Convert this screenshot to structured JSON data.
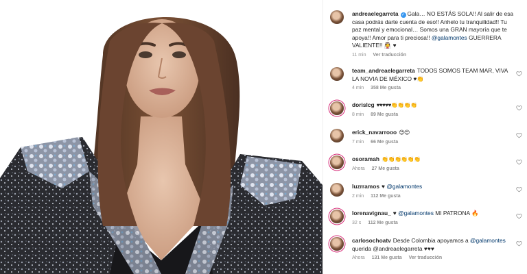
{
  "caption": {
    "username": "andreaelegarreta",
    "text_a": "Gala… NO ESTÁS SOLA!! Al salir de esa casa podrás darte cuenta de eso!! Anhelo tu tranquilidad!! Tu paz mental y emocional… Somos una GRAN mayoría que te apoya!! Amor para ti preciosa!!",
    "mention": "@galamontes",
    "text_b": "GUERRERA VALIENTE!! 👰 ♥",
    "time": "11 min",
    "translate": "Ver traducción"
  },
  "comments": [
    {
      "username": "team_andreaelegarreta",
      "text": "TODOS SOMOS TEAM MAR, VIVA LA NOVIA DE MÉXICO ♥👏",
      "mention": "",
      "text_after": "",
      "time": "4 min",
      "likes": "358 Me gusta",
      "extra": ""
    },
    {
      "username": "dorislcg",
      "text": "♥♥♥♥♥👏👏👏👏",
      "mention": "",
      "text_after": "",
      "time": "8 min",
      "likes": "89 Me gusta",
      "extra": ""
    },
    {
      "username": "erick_navarrooo",
      "text": "😍😍",
      "mention": "",
      "text_after": "",
      "time": "7 min",
      "likes": "66 Me gusta",
      "extra": ""
    },
    {
      "username": "osoramah",
      "text": "👏👏👏👏👏👏",
      "mention": "",
      "text_after": "",
      "time": "Ahora",
      "likes": "27 Me gusta",
      "extra": ""
    },
    {
      "username": "luzrramos",
      "text": "♥ ",
      "mention": "@galamontes",
      "text_after": "",
      "time": "2 min",
      "likes": "112 Me gusta",
      "extra": ""
    },
    {
      "username": "lorenavignau_",
      "text": "♥ ",
      "mention": "@galamontes",
      "text_after": " MI PATRONA 🔥",
      "time": "32 s",
      "likes": "112 Me gusta",
      "extra": ""
    },
    {
      "username": "carlosochoatv",
      "text": "Desde Colombia apoyamos a ",
      "mention": "@galamontes",
      "text_after": " querida @andreaelegarreta ♥♥♥",
      "time": "Ahora",
      "likes": "131 Me gusta",
      "extra": "Ver traducción"
    }
  ],
  "colors": {
    "mention": "#00376b",
    "meta": "#8e8e8e",
    "text": "#262626",
    "verified": "#3897f0",
    "heart_red": "#e0245e"
  },
  "icons": {
    "like": "heart-outline-icon",
    "verified": "verified-badge-icon"
  }
}
